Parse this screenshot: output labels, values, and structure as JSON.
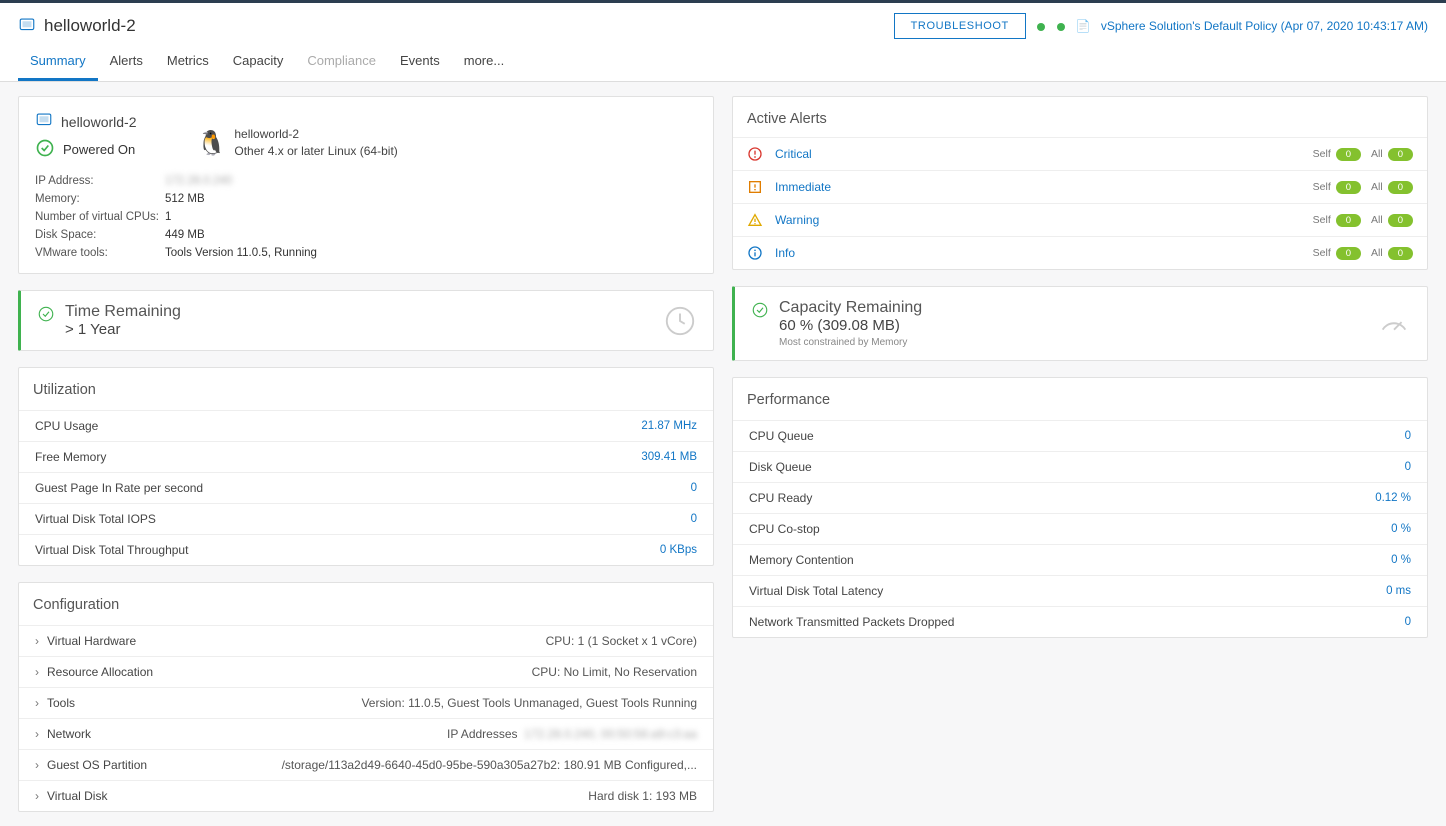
{
  "header": {
    "title": "helloworld-2",
    "troubleshoot": "TROUBLESHOOT",
    "policy": "vSphere Solution's Default Policy (Apr 07, 2020 10:43:17 AM)"
  },
  "tabs": {
    "summary": "Summary",
    "alerts": "Alerts",
    "metrics": "Metrics",
    "capacity": "Capacity",
    "compliance": "Compliance",
    "events": "Events",
    "more": "more..."
  },
  "vmCard": {
    "name": "helloworld-2",
    "power": "Powered On",
    "osName": "helloworld-2",
    "osDesc": "Other 4.x or later Linux (64-bit)",
    "props": {
      "ipLabel": "IP Address:",
      "ipValue": "172.28.0.240",
      "memLabel": "Memory:",
      "memValue": "512 MB",
      "cpuLabel": "Number of virtual CPUs:",
      "cpuValue": "1",
      "diskLabel": "Disk Space:",
      "diskValue": "449 MB",
      "toolsLabel": "VMware tools:",
      "toolsValue": "Tools Version 11.0.5, Running"
    }
  },
  "time": {
    "title": "Time Remaining",
    "value": "> 1 Year"
  },
  "capacity": {
    "title": "Capacity Remaining",
    "value": "60 % (309.08 MB)",
    "sub": "Most constrained by Memory"
  },
  "utilization": {
    "title": "Utilization",
    "rows": [
      {
        "label": "CPU Usage",
        "value": "21.87 MHz"
      },
      {
        "label": "Free Memory",
        "value": "309.41 MB"
      },
      {
        "label": "Guest Page In Rate per second",
        "value": "0"
      },
      {
        "label": "Virtual Disk Total IOPS",
        "value": "0"
      },
      {
        "label": "Virtual Disk Total Throughput",
        "value": "0 KBps"
      }
    ]
  },
  "configuration": {
    "title": "Configuration",
    "rows": [
      {
        "label": "Virtual Hardware",
        "value": "CPU: 1 (1 Socket x 1 vCore)"
      },
      {
        "label": "Resource Allocation",
        "value": "CPU: No Limit, No Reservation"
      },
      {
        "label": "Tools",
        "value": "Version: 11.0.5, Guest Tools Unmanaged, Guest Tools Running"
      },
      {
        "label": "Network",
        "value": "IP Addresses"
      },
      {
        "label": "Guest OS Partition",
        "value": "/storage/113a2d49-6640-45d0-95be-590a305a27b2: 180.91 MB Configured,..."
      },
      {
        "label": "Virtual Disk",
        "value": "Hard disk 1: 193 MB"
      }
    ],
    "network_blur": "172.28.0.240, 00:50:56:a9:c3:aa"
  },
  "activeAlerts": {
    "title": "Active Alerts",
    "rows": [
      {
        "level": "Critical",
        "selfLabel": "Self",
        "selfCount": "0",
        "allLabel": "All",
        "allCount": "0",
        "icon": "critical"
      },
      {
        "level": "Immediate",
        "selfLabel": "Self",
        "selfCount": "0",
        "allLabel": "All",
        "allCount": "0",
        "icon": "immediate"
      },
      {
        "level": "Warning",
        "selfLabel": "Self",
        "selfCount": "0",
        "allLabel": "All",
        "allCount": "0",
        "icon": "warning"
      },
      {
        "level": "Info",
        "selfLabel": "Self",
        "selfCount": "0",
        "allLabel": "All",
        "allCount": "0",
        "icon": "info"
      }
    ]
  },
  "performance": {
    "title": "Performance",
    "rows": [
      {
        "label": "CPU Queue",
        "value": "0"
      },
      {
        "label": "Disk Queue",
        "value": "0"
      },
      {
        "label": "CPU Ready",
        "value": "0.12 %"
      },
      {
        "label": "CPU Co-stop",
        "value": "0 %"
      },
      {
        "label": "Memory Contention",
        "value": "0 %"
      },
      {
        "label": "Virtual Disk Total Latency",
        "value": "0 ms"
      },
      {
        "label": "Network Transmitted Packets Dropped",
        "value": "0"
      }
    ]
  }
}
